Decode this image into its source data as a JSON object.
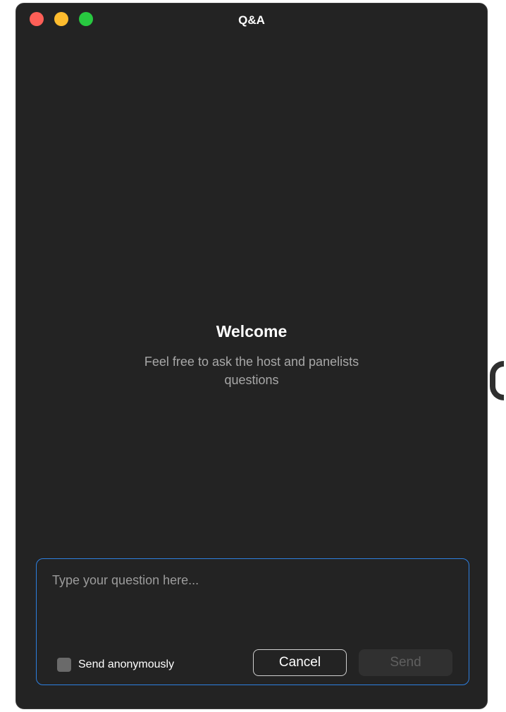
{
  "window": {
    "title": "Q&A"
  },
  "welcome": {
    "heading": "Welcome",
    "subtitle": "Feel free to ask the host and panelists questions"
  },
  "composer": {
    "placeholder": "Type your question here...",
    "anonymous_label": "Send anonymously",
    "anonymous_checked": false,
    "cancel_label": "Cancel",
    "send_label": "Send",
    "send_enabled": false
  },
  "colors": {
    "background": "#232323",
    "accent_border": "#2d7fe0",
    "close": "#fe5f57",
    "minimize": "#febc2e",
    "maximize": "#28c840"
  }
}
